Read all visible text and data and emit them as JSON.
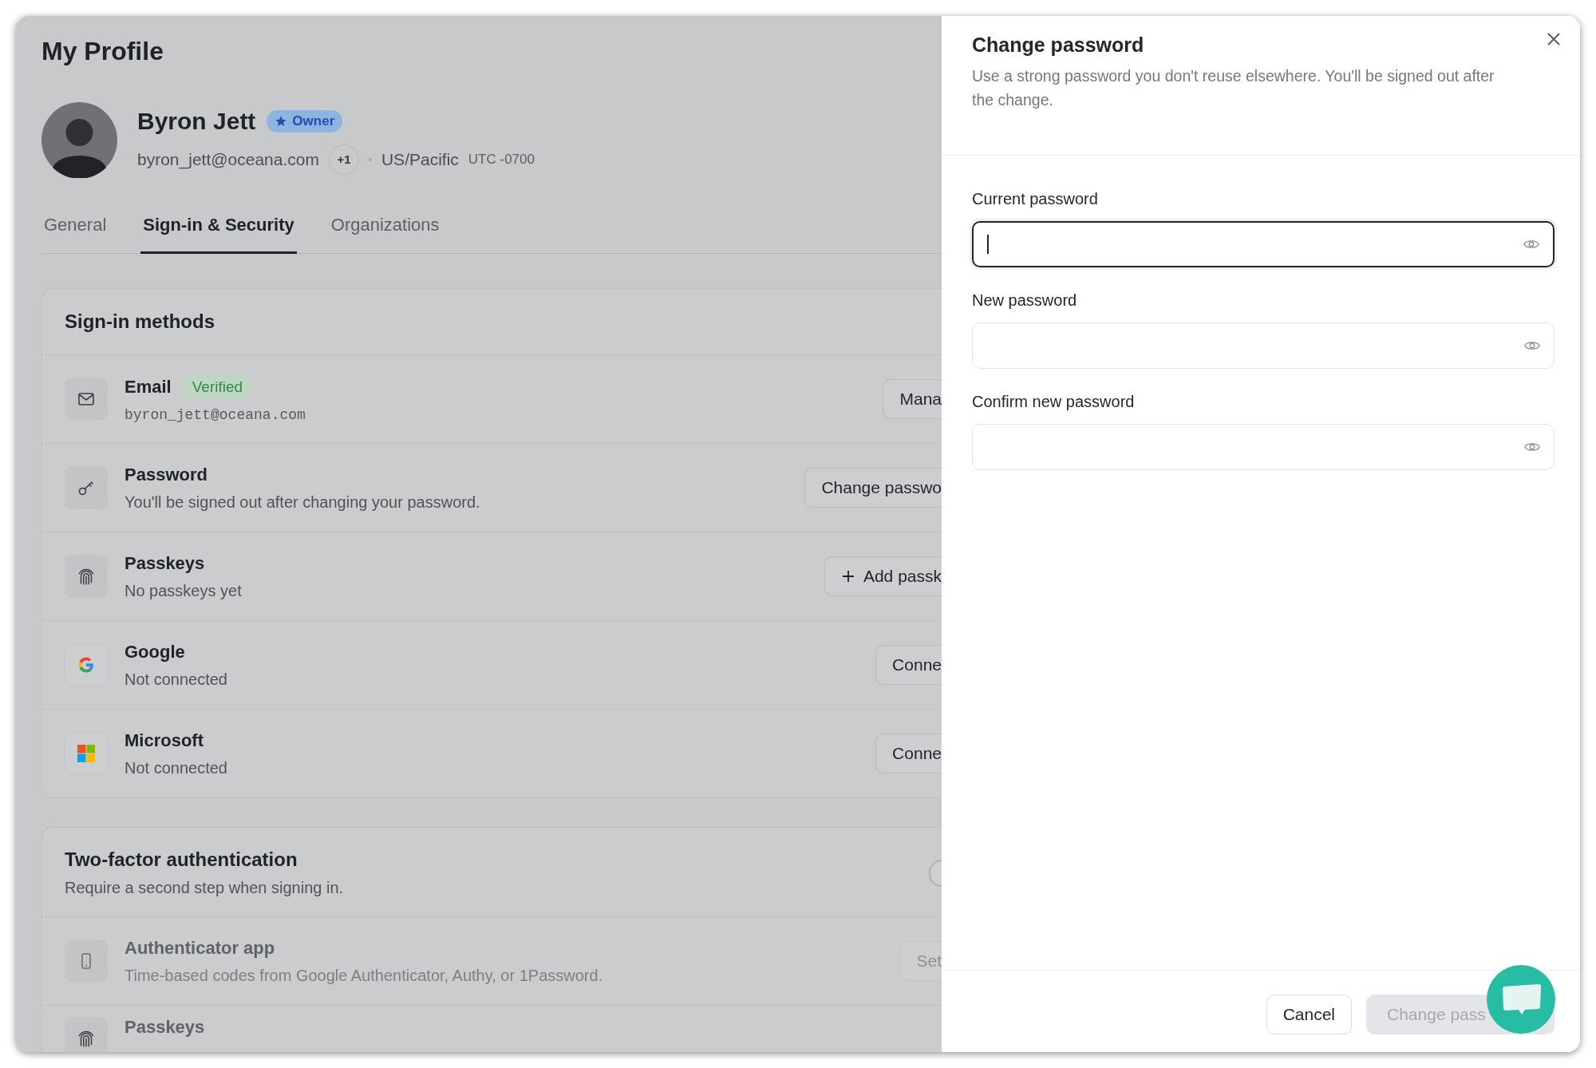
{
  "page_title": "My Profile",
  "profile": {
    "name": "Byron Jett",
    "role_badge": "Owner",
    "email": "byron_jett@oceana.com",
    "extra_emails": "+1",
    "timezone": "US/Pacific",
    "utc_offset": "UTC -0700"
  },
  "tabs": [
    {
      "label": "General",
      "selected": false
    },
    {
      "label": "Sign-in & Security",
      "selected": true
    },
    {
      "label": "Organizations",
      "selected": false
    }
  ],
  "sign_in_methods": {
    "title": "Sign-in methods",
    "rows": [
      {
        "kind": "email",
        "title": "Email",
        "badge": "Verified",
        "detail": "byron_jett@oceana.com",
        "action": "Mana"
      },
      {
        "kind": "password",
        "title": "Password",
        "detail": "You'll be signed out after changing your password.",
        "action": "Change passwo"
      },
      {
        "kind": "passkey",
        "title": "Passkeys",
        "detail": "No passkeys yet",
        "action": "Add passk"
      },
      {
        "kind": "google",
        "title": "Google",
        "detail": "Not connected",
        "action": "Conne"
      },
      {
        "kind": "microsoft",
        "title": "Microsoft",
        "detail": "Not connected",
        "action": "Conne"
      }
    ]
  },
  "two_factor": {
    "title": "Two-factor authentication",
    "subtitle": "Require a second step when signing in.",
    "enabled": false,
    "rows": [
      {
        "kind": "phone",
        "title": "Authenticator app",
        "detail": "Time-based codes from Google Authenticator, Authy, or 1Password.",
        "action": "Set",
        "disabled": true
      },
      {
        "kind": "passkey",
        "title": "Passkeys",
        "disabled": true
      }
    ]
  },
  "change_password": {
    "title": "Change password",
    "description": "Use a strong password you don't reuse elsewhere. You'll be signed out after the change.",
    "fields": [
      {
        "label": "Current password",
        "focused": true
      },
      {
        "label": "New password",
        "focused": false
      },
      {
        "label": "Confirm new password",
        "focused": false
      }
    ],
    "cancel": "Cancel",
    "submit": "Change pass",
    "submit_disabled": true
  }
}
